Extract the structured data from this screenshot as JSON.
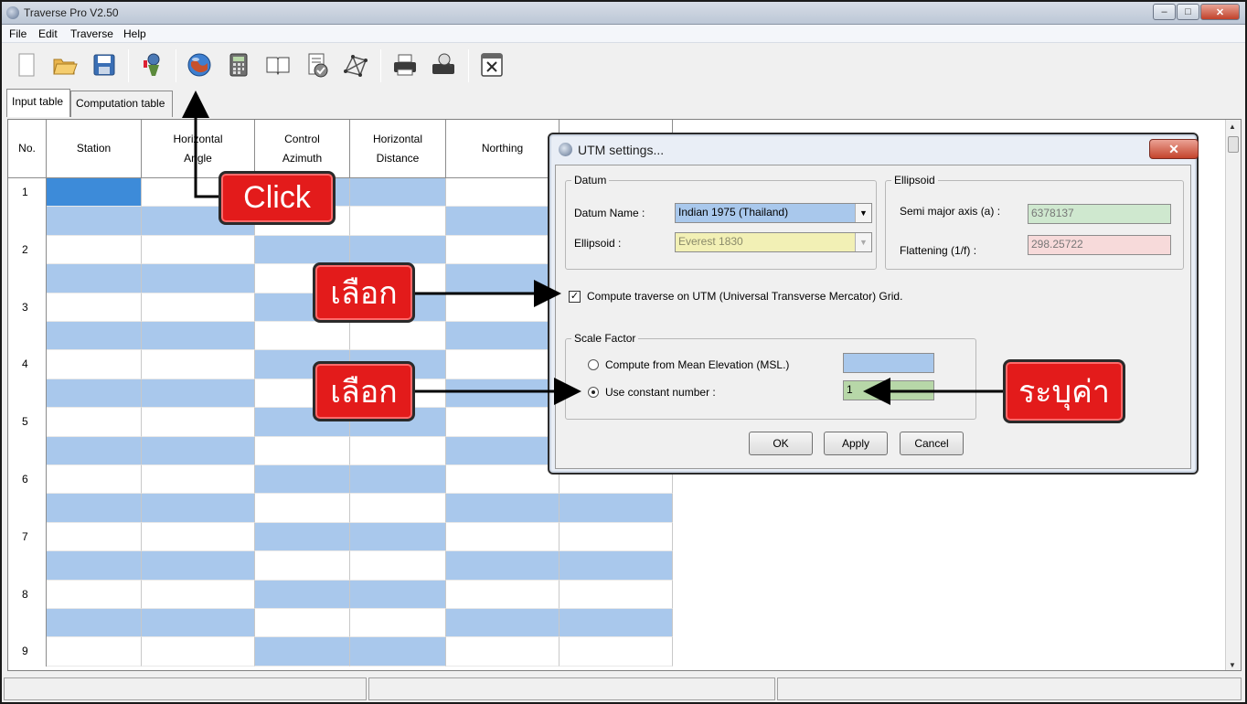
{
  "app": {
    "title": "Traverse Pro V2.50",
    "window_buttons": {
      "minimize": "–",
      "maximize": "□",
      "close": "✕"
    }
  },
  "menu": [
    "File",
    "Edit",
    "Traverse",
    "Help"
  ],
  "toolbar": {
    "icons": [
      "new-file-icon",
      "open-folder-icon",
      "save-icon",
      "survey-tool-icon",
      "utm-globe-icon",
      "calculator-icon",
      "book-icon",
      "checklist-icon",
      "grid-network-icon",
      "printer-icon",
      "print-preview-icon",
      "excel-export-icon"
    ]
  },
  "tabs": [
    "Input table",
    "Computation table"
  ],
  "table": {
    "headers": [
      "No.",
      "Station",
      "Horizontal\nAngle",
      "Control\nAzimuth",
      "Horizontal\nDistance",
      "Northing",
      ""
    ],
    "row_numbers": [
      "1",
      "2",
      "3",
      "4",
      "5",
      "6",
      "7",
      "8",
      "9"
    ]
  },
  "dialog": {
    "title": "UTM settings...",
    "close_label": "✕",
    "datum": {
      "group_label": "Datum",
      "name_label": "Datum Name :",
      "name_value": "Indian 1975 (Thailand)",
      "ellipsoid_label": "Ellipsoid :",
      "ellipsoid_value": "Everest 1830"
    },
    "ellipsoid": {
      "group_label": "Ellipsoid",
      "semi_major_label": "Semi major axis (a) :",
      "semi_major_value": "6378137",
      "flattening_label": "Flattening (1/f) :",
      "flattening_value": "298.25722"
    },
    "utm_checkbox": {
      "label": "Compute traverse on UTM (Universal Transverse Mercator) Grid.",
      "checked": true
    },
    "scale_factor": {
      "group_label": "Scale Factor",
      "mean_elevation_label": "Compute from Mean Elevation (MSL.)",
      "mean_elevation_value": "",
      "constant_label": "Use constant number :",
      "constant_value": "1",
      "selected": "constant"
    },
    "buttons": {
      "ok": "OK",
      "apply": "Apply",
      "cancel": "Cancel"
    }
  },
  "annotations": {
    "click": "Click",
    "select_1": "เลือก",
    "select_2": "เลือก",
    "specify": "ระบุค่า"
  },
  "colors": {
    "row_blue": "#a9c8ec",
    "selected_cell": "#3d8bd9",
    "callout_red": "#e31b1b",
    "datum_field": "#a9c8ec",
    "ellipsoid_field": "#f2f0b5",
    "semi_major_field": "#cfe8cf",
    "flattening_field": "#f7dada"
  }
}
